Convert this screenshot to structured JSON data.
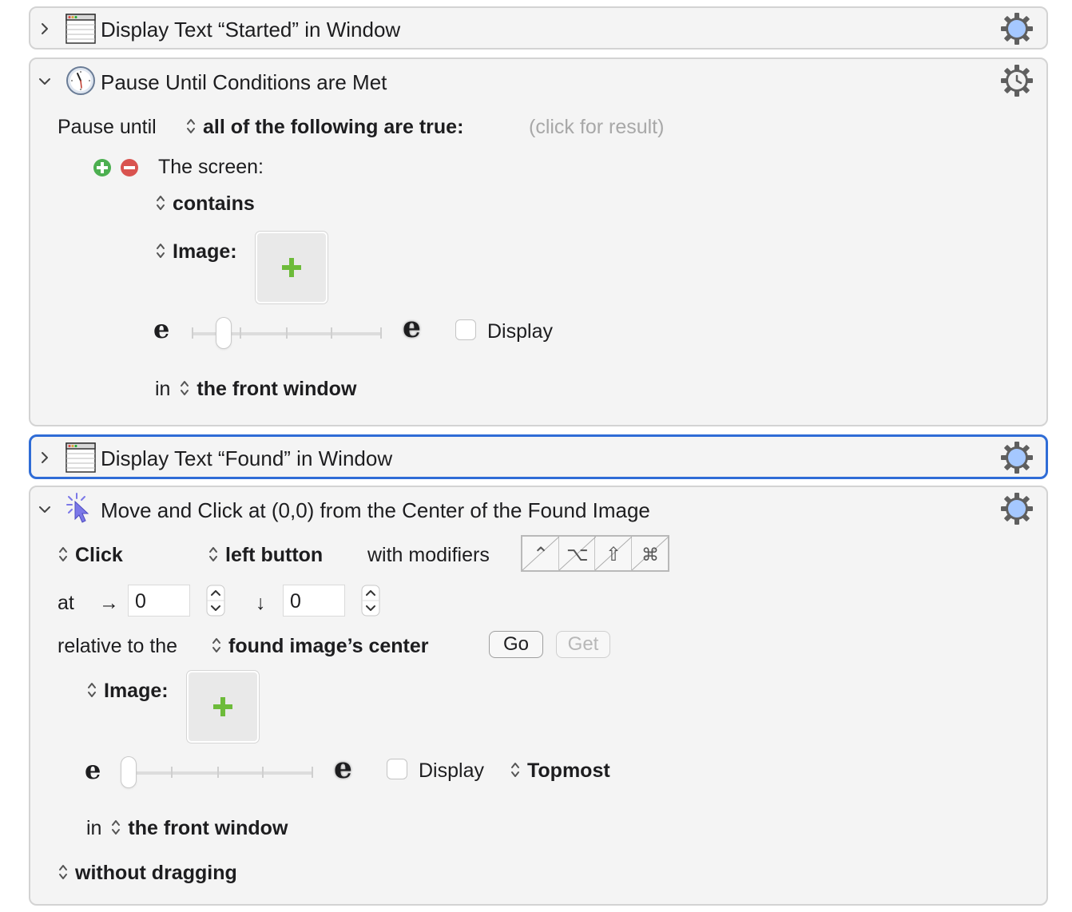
{
  "actions": [
    {
      "title": "Display Text “Started” in Window",
      "icon": "window-icon",
      "expanded": false
    },
    {
      "title": "Pause Until Conditions are Met",
      "icon": "clock-icon",
      "expanded": true,
      "pause_until_label": "Pause until",
      "condition_mode": "all of the following are true:",
      "result_hint": "(click for result)",
      "condition_label": "The screen:",
      "screen_relation": "contains",
      "image_label": "Image:",
      "display_label": "Display",
      "in_label": "in",
      "area": "the front window"
    },
    {
      "title": "Display Text “Found” in Window",
      "icon": "window-icon",
      "expanded": false,
      "selected": true
    },
    {
      "title": "Move and Click at (0,0) from the Center of the Found Image",
      "icon": "cursor-click-icon",
      "expanded": true,
      "click_type": "Click",
      "button": "left button",
      "with_modifiers_label": "with modifiers",
      "modifiers": [
        "⌃",
        "⌥",
        "⇧",
        "⌘"
      ],
      "at_label": "at",
      "x_arrow": "→",
      "x_value": "0",
      "y_arrow": "↓",
      "y_value": "0",
      "relative_label": "relative to the",
      "relative_to": "found image’s center",
      "go_label": "Go",
      "get_label": "Get",
      "image_label": "Image:",
      "display_label": "Display",
      "topmost": "Topmost",
      "in_label": "in",
      "area": "the front window",
      "dragging": "without dragging"
    }
  ],
  "slider_glyph": "e",
  "colors": {
    "selection": "#2f6cd6",
    "panel": "#f4f4f4",
    "add": "#4caf50",
    "remove": "#d9534f",
    "gear": "#a5c8ff"
  }
}
